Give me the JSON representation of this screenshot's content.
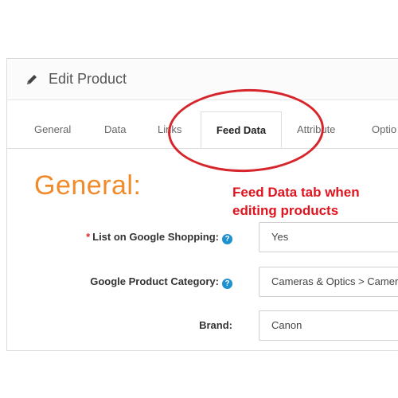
{
  "panel": {
    "title": "Edit Product",
    "title_icon": "pencil-icon"
  },
  "tabs": [
    {
      "label": "General",
      "active": false
    },
    {
      "label": "Data",
      "active": false
    },
    {
      "label": "Links",
      "active": false
    },
    {
      "label": "Feed Data",
      "active": true
    },
    {
      "label": "Attribute",
      "active": false
    },
    {
      "label": "Optio",
      "active": false
    }
  ],
  "section": {
    "title": "General:"
  },
  "form": {
    "list_on_google_shopping": {
      "required_mark": "*",
      "label": "List on Google Shopping:",
      "value": "Yes"
    },
    "google_product_category": {
      "label": "Google Product Category:",
      "value": "Cameras & Optics > Cameras"
    },
    "brand": {
      "label": "Brand:",
      "value": "Canon"
    },
    "help_icon_glyph": "?"
  },
  "annotation": {
    "line1": "Feed Data tab when",
    "line2": "editing products",
    "color": "#e0141e"
  },
  "colors": {
    "accent": "#f18a2b",
    "help_icon": "#1e91cf",
    "required": "#e4262b"
  }
}
